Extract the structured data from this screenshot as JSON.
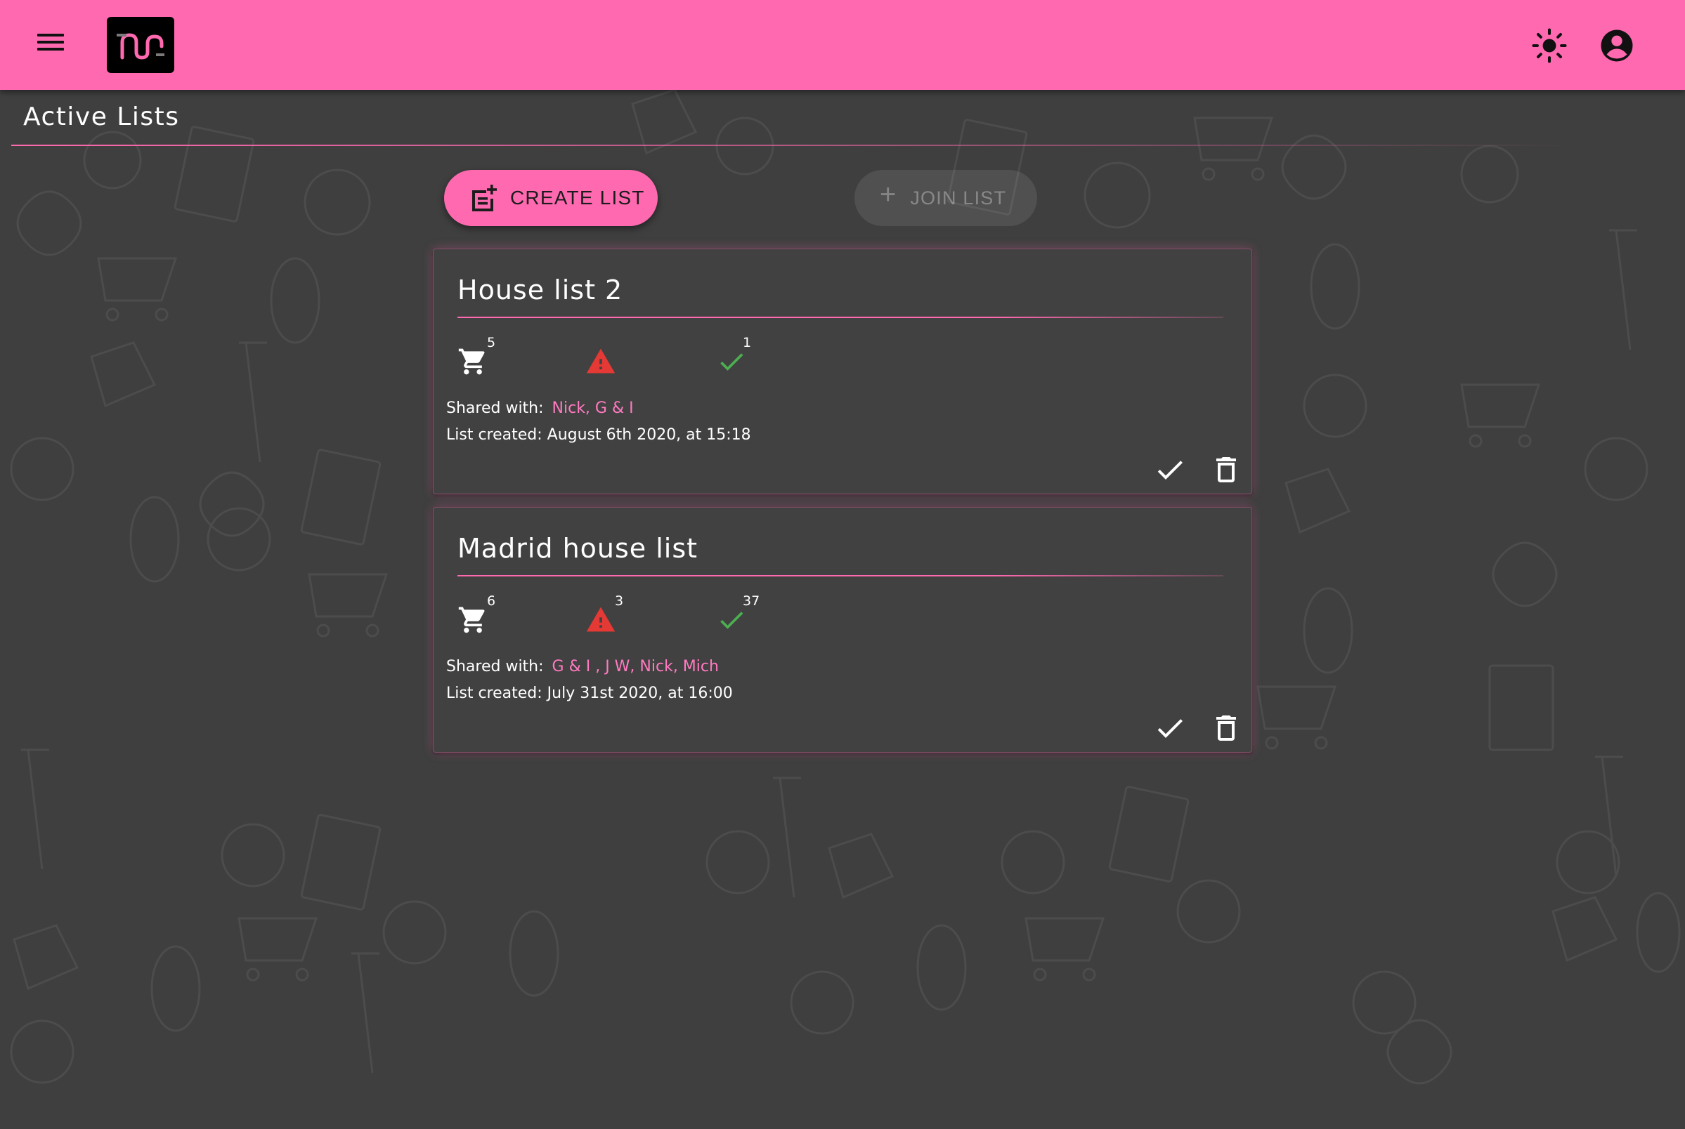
{
  "header": {
    "menu_icon": "menu-icon",
    "logo_icon": "app-logo",
    "theme_icon": "sun-icon",
    "account_icon": "account-circle-icon",
    "color": "#ff69b0"
  },
  "page": {
    "title": "Active Lists"
  },
  "actions": {
    "create_label": "CREATE LIST",
    "create_icon": "note-add-icon",
    "join_label": "JOIN LIST",
    "join_icon": "plus-icon",
    "join_disabled": true
  },
  "lists": [
    {
      "name": "House list 2",
      "cart_count": "5",
      "warning_count": "",
      "done_count": "1",
      "shared_label": "Shared with:",
      "shared_with": "Nick,  G & I",
      "created": "List created: August 6th 2020, at 15:18"
    },
    {
      "name": "Madrid house list",
      "cart_count": "6",
      "warning_count": "3",
      "done_count": "37",
      "shared_label": "Shared with:",
      "shared_with": "G & I ,  J W,  Nick,  Mich",
      "created": "List created: July 31st 2020, at 16:00"
    }
  ],
  "colors": {
    "accent": "#ff69b0",
    "warning": "#e53935",
    "success": "#4caf50",
    "background": "#3f3f3f"
  }
}
